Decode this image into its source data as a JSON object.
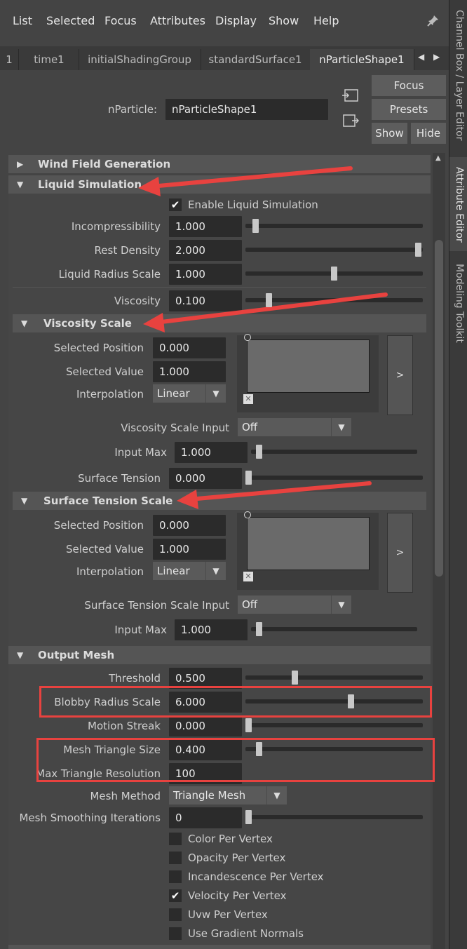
{
  "menu": [
    "List",
    "Selected",
    "Focus",
    "Attributes",
    "Display",
    "Show",
    "Help"
  ],
  "tabs": [
    "1",
    "time1",
    "initialShadingGroup",
    "standardSurface1",
    "nParticleShape1"
  ],
  "side_tabs": [
    "Channel Box / Layer Editor",
    "Attribute Editor",
    "Modeling Toolkit"
  ],
  "header": {
    "node_label": "nParticle:",
    "node_value": "nParticleShape1",
    "focus_label": "Focus",
    "presets_label": "Presets",
    "show_label": "Show",
    "hide_label": "Hide"
  },
  "sections": {
    "wind": "Wind Field Generation",
    "liquid": "Liquid Simulation",
    "viscosity_scale": "Viscosity Scale",
    "surface_tension_scale": "Surface Tension Scale",
    "output_mesh": "Output Mesh"
  },
  "liquid": {
    "enable_label": "Enable Liquid Simulation",
    "enable_checked": true,
    "fields": [
      {
        "label": "Incompressibility",
        "value": "1.000",
        "slider": 0.04
      },
      {
        "label": "Rest Density",
        "value": "2.000",
        "slider": 0.99
      },
      {
        "label": "Liquid Radius Scale",
        "value": "1.000",
        "slider": 0.5
      },
      {
        "label": "Viscosity",
        "value": "0.100",
        "slider": 0.12
      }
    ]
  },
  "viscosity_ramp": {
    "pos_label": "Selected Position",
    "pos_value": "0.000",
    "val_label": "Selected Value",
    "val_value": "1.000",
    "interp_label": "Interpolation",
    "interp_value": "Linear",
    "expand_label": ">",
    "input_label": "Viscosity Scale Input",
    "input_value": "Off",
    "max_label": "Input Max",
    "max_value": "1.000",
    "max_slider": 0.03,
    "tension_label": "Surface Tension",
    "tension_value": "0.000",
    "tension_slider": 0.0
  },
  "surface_ramp": {
    "pos_label": "Selected Position",
    "pos_value": "0.000",
    "val_label": "Selected Value",
    "val_value": "1.000",
    "interp_label": "Interpolation",
    "interp_value": "Linear",
    "expand_label": ">",
    "input_label": "Surface Tension Scale Input",
    "input_value": "Off",
    "max_label": "Input Max",
    "max_value": "1.000",
    "max_slider": 0.03
  },
  "output": {
    "fields": [
      {
        "label": "Threshold",
        "value": "0.500",
        "slider": 0.27
      },
      {
        "label": "Blobby Radius Scale",
        "value": "6.000",
        "slider": 0.6
      },
      {
        "label": "Motion Streak",
        "value": "0.000",
        "slider": 0.0
      },
      {
        "label": "Mesh Triangle Size",
        "value": "0.400",
        "slider": 0.06
      },
      {
        "label": "Max Triangle Resolution",
        "value": "100"
      }
    ],
    "method_label": "Mesh Method",
    "method_value": "Triangle Mesh",
    "smooth_label": "Mesh Smoothing Iterations",
    "smooth_value": "0",
    "smooth_slider": 0.0,
    "checkboxes": [
      {
        "label": "Color Per Vertex",
        "checked": false
      },
      {
        "label": "Opacity Per Vertex",
        "checked": false
      },
      {
        "label": "Incandescence Per Vertex",
        "checked": false
      },
      {
        "label": "Velocity Per Vertex",
        "checked": true
      },
      {
        "label": "Uvw Per Vertex",
        "checked": false
      },
      {
        "label": "Use Gradient Normals",
        "checked": false
      }
    ]
  },
  "colors": {
    "annotation": "#e8423f",
    "background": "#444444",
    "field": "#2b2b2b"
  }
}
